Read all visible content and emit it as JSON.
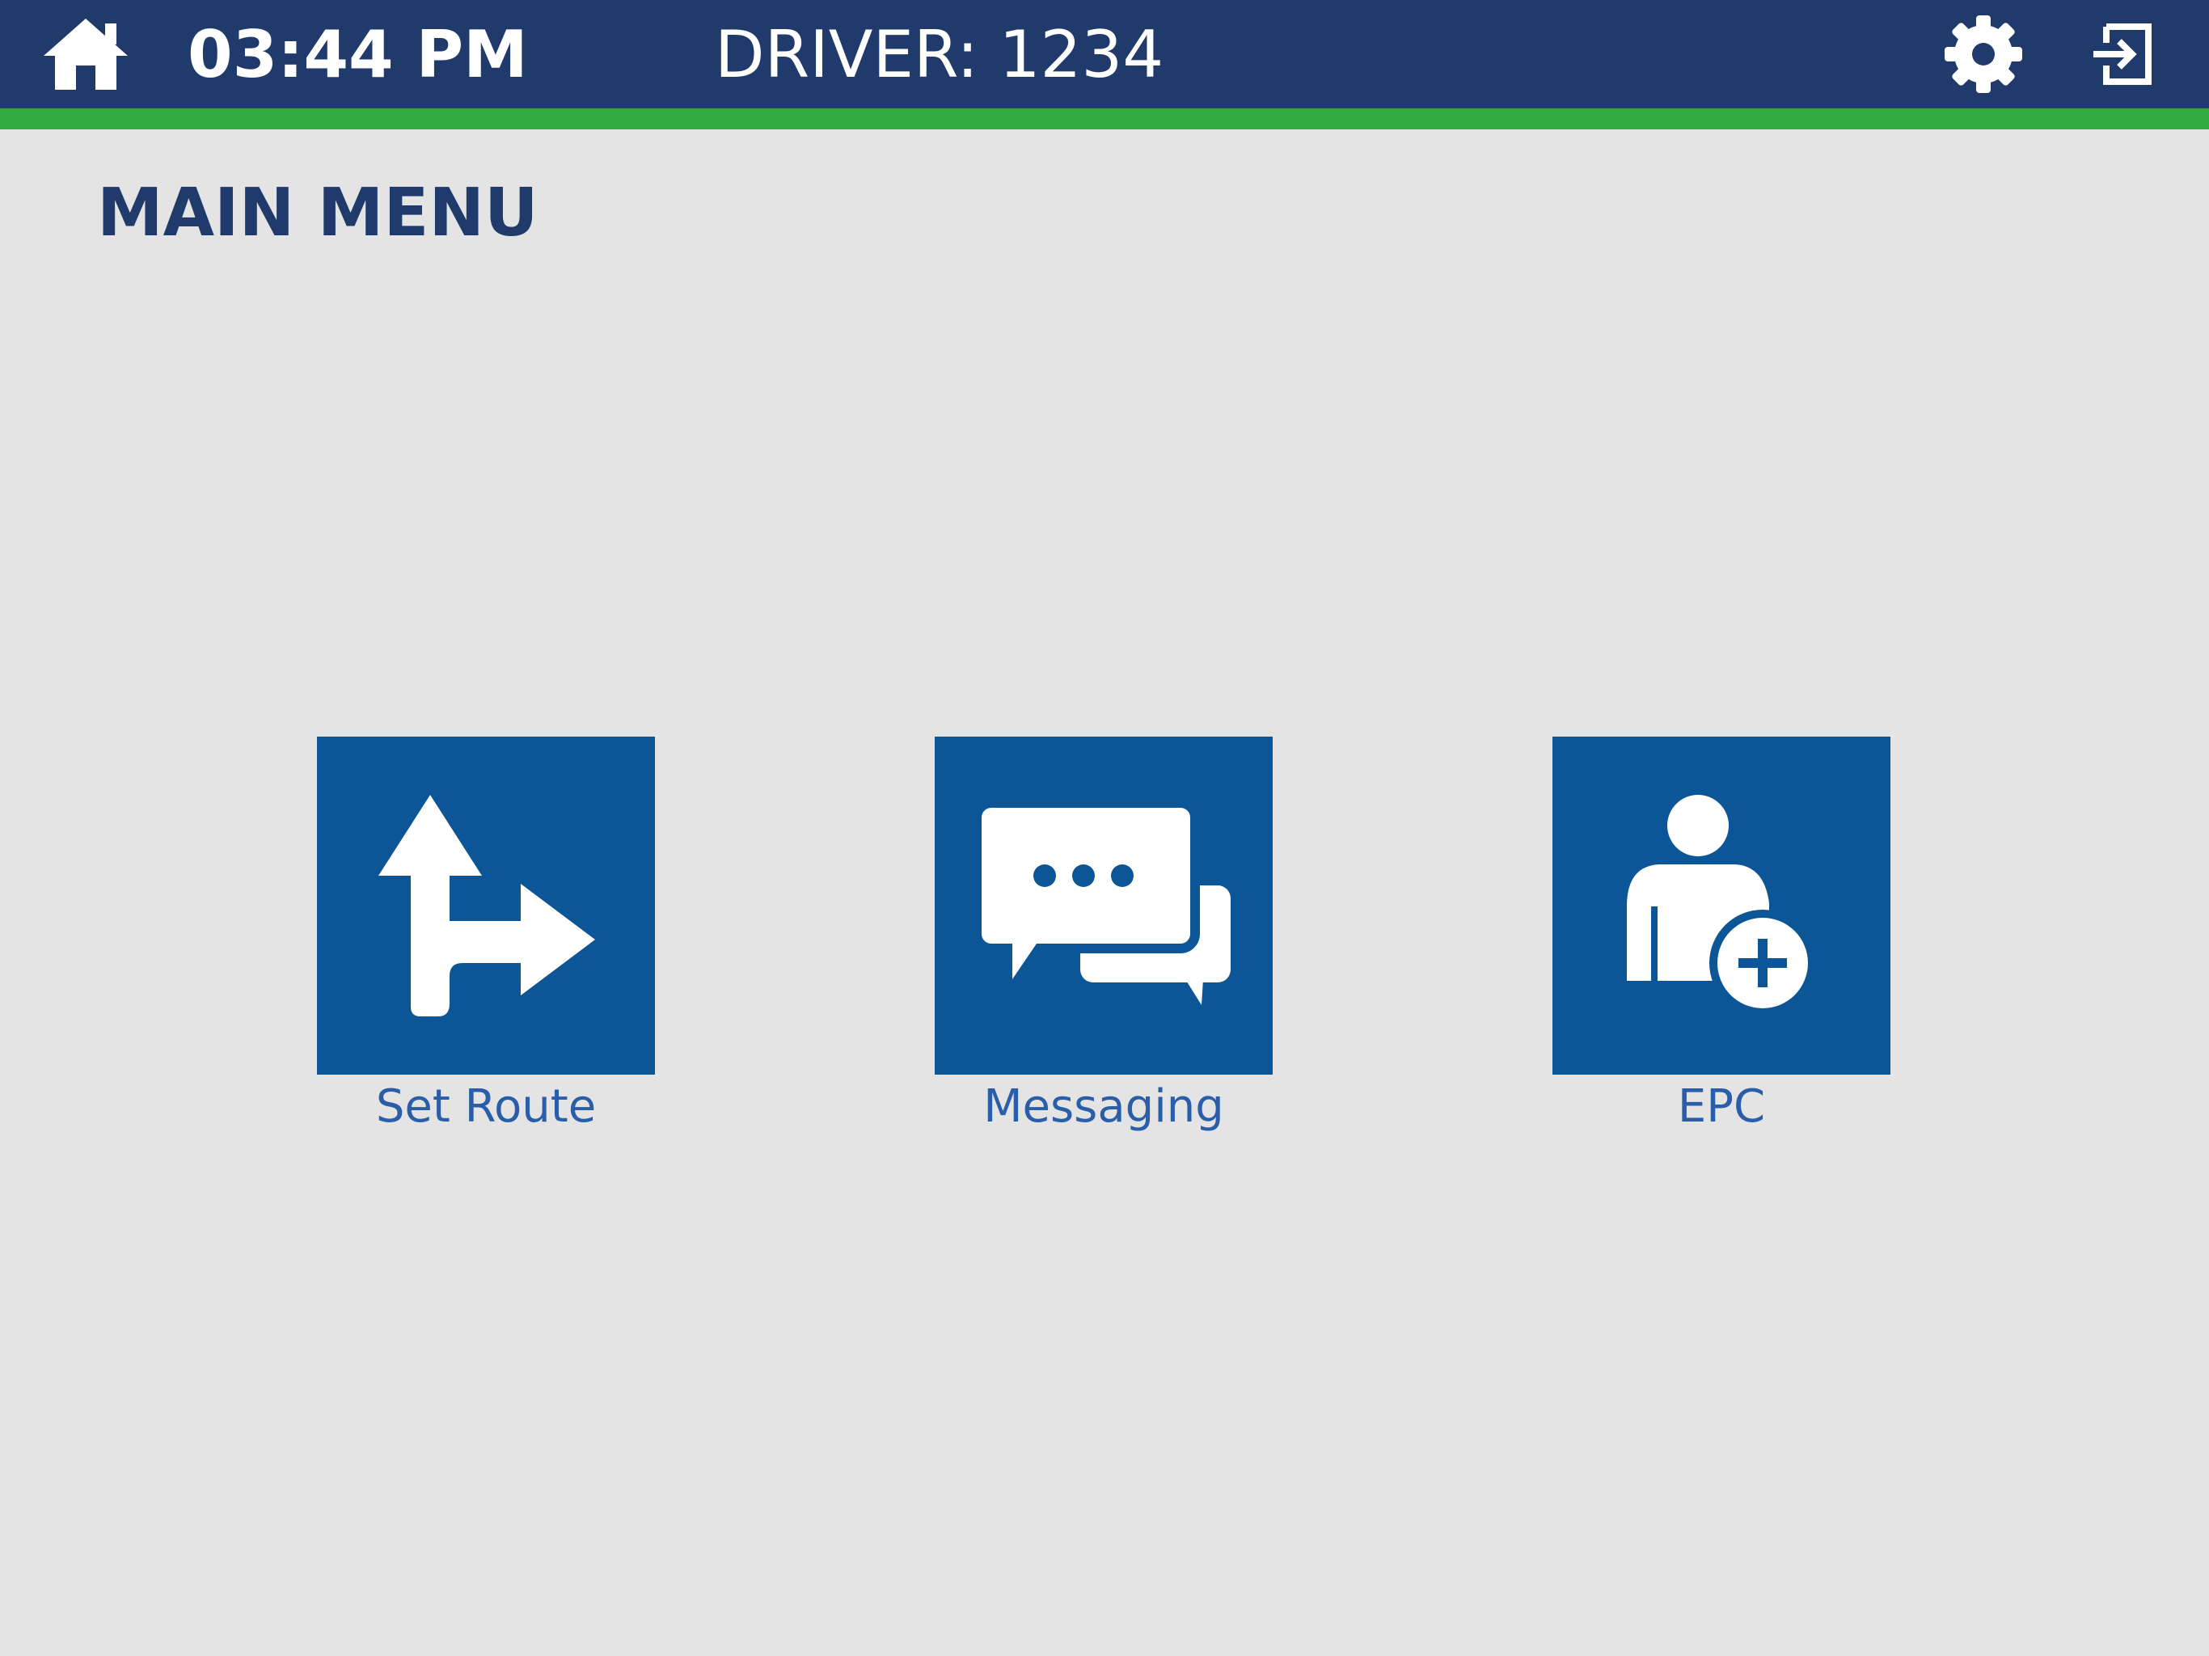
{
  "header": {
    "time": "03:44 PM",
    "driver": "DRIVER: 1234",
    "icons": {
      "home": "home-icon",
      "settings": "gear-icon",
      "logout": "logout-icon"
    }
  },
  "page": {
    "title": "MAIN MENU"
  },
  "menu": {
    "items": [
      {
        "label": "Set Route",
        "icon": "route-arrow-icon"
      },
      {
        "label": "Messaging",
        "icon": "chat-bubbles-icon"
      },
      {
        "label": "EPC",
        "icon": "add-person-icon"
      }
    ]
  },
  "colors": {
    "header_bg": "#1f3a6b",
    "accent_green": "#2eaa3f",
    "tile_blue": "#0c5597",
    "label_blue": "#2a5ea8",
    "background": "#e4e4e4"
  }
}
